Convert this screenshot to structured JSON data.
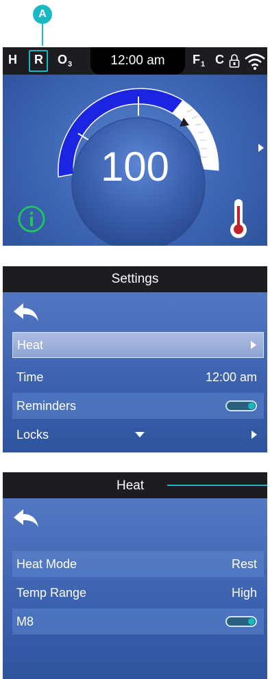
{
  "callout": {
    "label": "A"
  },
  "status_bar": {
    "heat_mode": "H",
    "rest_mode": "R",
    "ozone_o": "O",
    "ozone_sub": "3",
    "time": "12:00 am",
    "filter_f": "F",
    "filter_sub": "1",
    "clean": "C",
    "icons": [
      "lock-icon",
      "wifi-icon"
    ]
  },
  "home": {
    "temperature": "100",
    "icons": [
      "info-icon",
      "thermometer-icon",
      "right-arrow-icon"
    ],
    "colors": {
      "gauge": "#1b24e0",
      "info": "#1ec85a",
      "thermometer": "#c8202b"
    }
  },
  "settings": {
    "title": "Settings",
    "items": [
      {
        "label": "Heat",
        "value": ""
      },
      {
        "label": "Time",
        "value": "12:00 am"
      },
      {
        "label": "Reminders",
        "value": ""
      },
      {
        "label": "Locks",
        "value": ""
      }
    ]
  },
  "heat": {
    "title": "Heat",
    "items": [
      {
        "label": "Heat Mode",
        "value": "Rest"
      },
      {
        "label": "Temp Range",
        "value": "High"
      },
      {
        "label": "M8",
        "value": ""
      }
    ]
  },
  "accent_color": "#19b9c4"
}
